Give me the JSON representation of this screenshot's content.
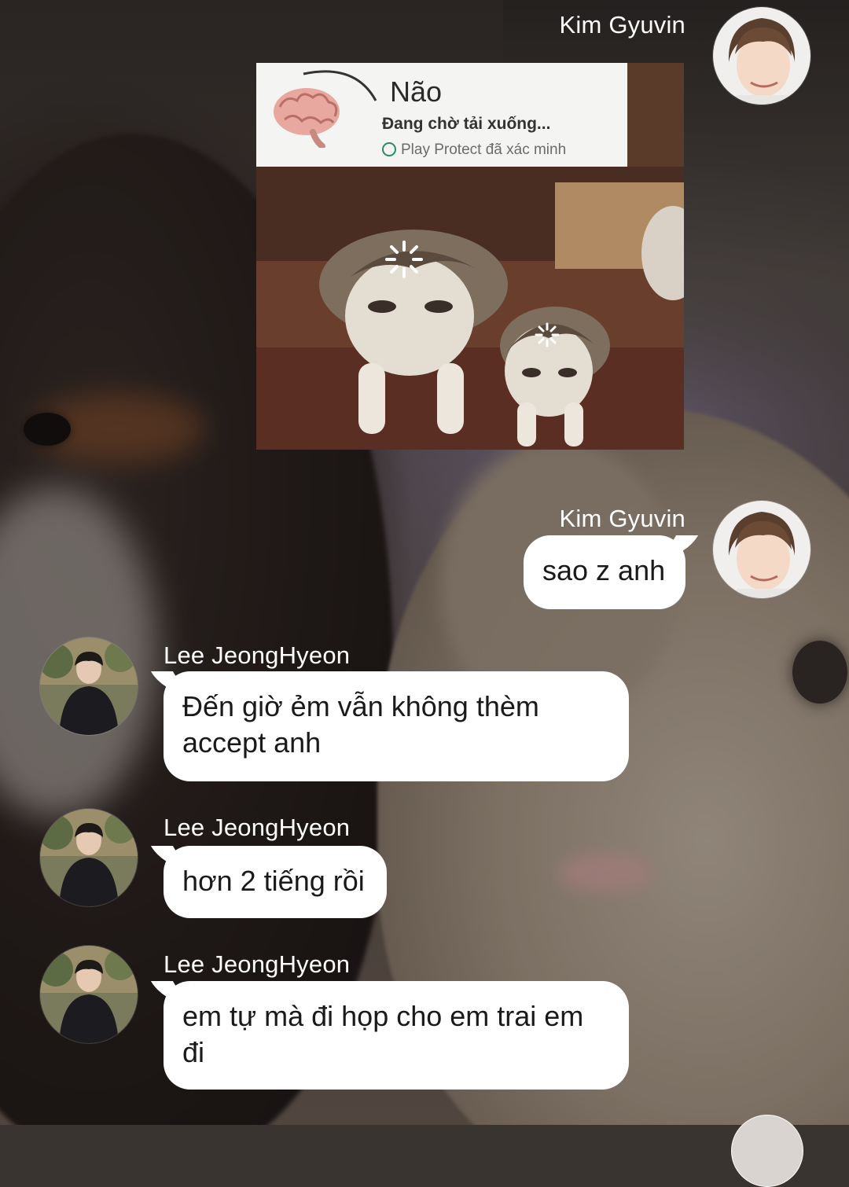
{
  "messages": [
    {
      "sender": "Kim Gyuvin",
      "side": "out",
      "type": "image",
      "image": {
        "app_name": "Não",
        "status": "Đang chờ tải xuống...",
        "protect": "Play Protect đã xác minh",
        "icons": [
          "brain-icon",
          "loading-spinner-icon"
        ]
      }
    },
    {
      "sender": "Kim Gyuvin",
      "side": "out",
      "type": "text",
      "text": "sao z anh"
    },
    {
      "sender": "Lee JeongHyeon",
      "side": "in",
      "type": "text",
      "text": "Đến giờ ẻm vẫn không thèm accept anh"
    },
    {
      "sender": "Lee JeongHyeon",
      "side": "in",
      "type": "text",
      "text": "hơn 2 tiếng rồi"
    },
    {
      "sender": "Lee JeongHyeon",
      "side": "in",
      "type": "text",
      "text": "em tự mà đi họp cho em trai em đi"
    }
  ],
  "colors": {
    "bubble": "#ffffff",
    "sender_text": "#ffffff",
    "message_text": "#1a1a1a",
    "protect_shield": "#2a8a6c"
  }
}
